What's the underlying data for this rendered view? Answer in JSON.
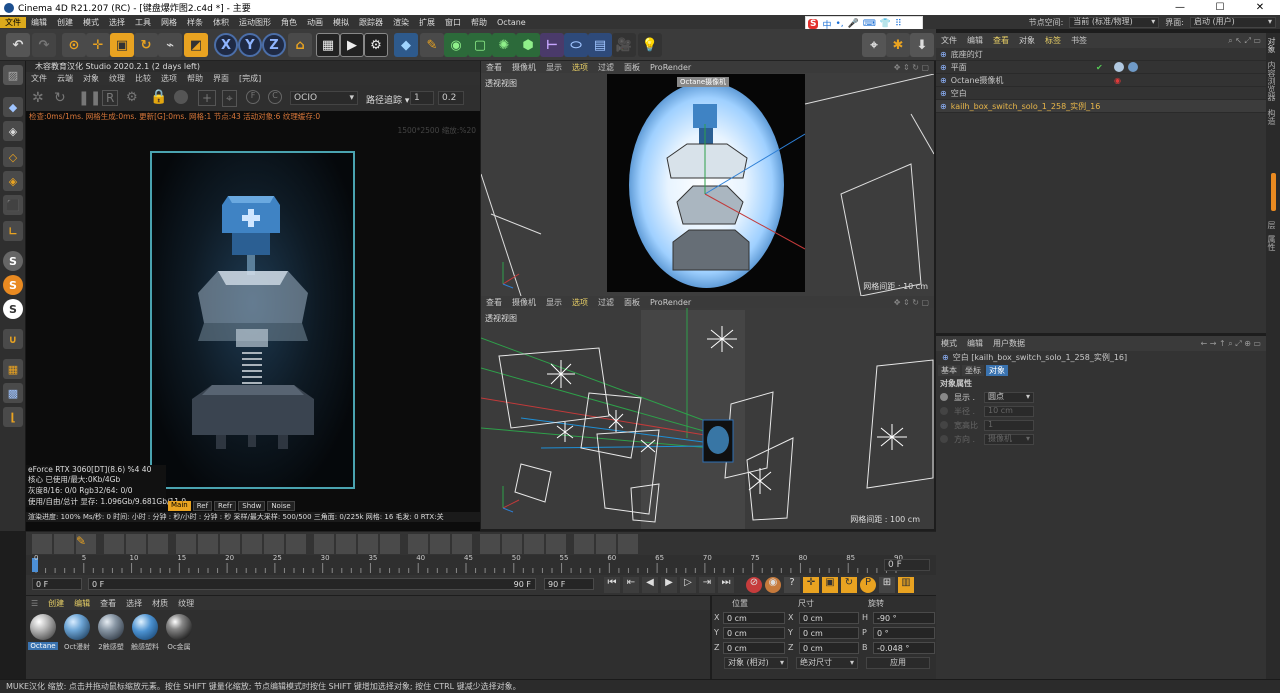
{
  "window": {
    "title": "Cinema 4D R21.207 (RC) - [键盘爆炸图2.c4d *] - 主要",
    "controls": [
      "—",
      "☐",
      "✕"
    ]
  },
  "menubar": {
    "items": [
      "文件",
      "编辑",
      "创建",
      "模式",
      "选择",
      "工具",
      "网格",
      "样条",
      "体积",
      "运动图形",
      "角色",
      "动画",
      "模拟",
      "跟踪器",
      "渲染",
      "扩展",
      "窗口",
      "帮助",
      "Octane"
    ],
    "node_space_label": "节点空间:",
    "node_space_value": "当前 (标准/物理)",
    "interface_label": "界面:",
    "interface_value": "启动 (用户)",
    "ime_items": [
      "S",
      "中",
      "•,",
      "🎤",
      "⌨",
      "👕",
      "⠿"
    ]
  },
  "live_viewer": {
    "title": "木容教育汉化 Studio 2020.2.1 (2 days left)",
    "menu": [
      "文件",
      "云端",
      "对象",
      "纹理",
      "比较",
      "选项",
      "帮助",
      "界面",
      "[完成]"
    ],
    "ocio": "OCIO",
    "path_tracing": "路径追踪",
    "spinner1": "1",
    "spinner2": "0.2",
    "status": "检查:0ms/1ms. 网格生成:0ms. 更新[G]:0ms. 网格:1 节点:43 活动对象:6 纹理缓存:0",
    "res": "1500*2500 缩放:%20",
    "gpu_line": "eForce RTX 3060[DT](8.6)  %4       40",
    "core_line": "核心 已使用/最大:0Kb/4Gb",
    "gray_line": "灰度8/16: 0/0           Rgb32/64: 0/0",
    "mem_line": "使用/自由/总计 显存: 1.096Gb/9.681Gb/11.9",
    "tabs": [
      "Main",
      "Ref",
      "Refr",
      "Shdw",
      "Noise"
    ],
    "render_line": "渲染进度: 100%  Ms/秒: 0    时间: 小时 : 分钟 : 秒/小时 : 分钟 : 秒    采样/最大采样: 500/500    三角面: 0/225k    网格: 16    毛发: 0    RTX:关"
  },
  "viewport_top": {
    "menu": [
      "查看",
      "摄像机",
      "显示",
      "选项",
      "过滤",
      "面板",
      "ProRender"
    ],
    "label": "透视视图",
    "camera_tag": "Octane摄像机",
    "grid": "网格间距 : 10 cm"
  },
  "viewport_bottom": {
    "menu": [
      "查看",
      "摄像机",
      "显示",
      "选项",
      "过滤",
      "面板",
      "ProRender"
    ],
    "label": "透视视图",
    "grid": "网格间距 : 100 cm"
  },
  "object_manager": {
    "menu": [
      "文件",
      "编辑",
      "查看",
      "对象",
      "标签",
      "书签"
    ],
    "items": [
      {
        "name": "底座的灯",
        "color": "#c8c8c8"
      },
      {
        "name": "平面",
        "color": "#c8c8c8"
      },
      {
        "name": "Octane摄像机",
        "color": "#c8c8c8"
      },
      {
        "name": "空白",
        "color": "#c8c8c8"
      },
      {
        "name": "kailh_box_switch_solo_1_258_实例_16",
        "color": "#e8b64a"
      }
    ]
  },
  "right_tabs": [
    "对象",
    "内容浏览器",
    "构造",
    "层",
    "属性"
  ],
  "attributes": {
    "menu": [
      "模式",
      "编辑",
      "用户数据"
    ],
    "object_title": "空白 [kailh_box_switch_solo_1_258_实例_16]",
    "tabs": [
      "基本",
      "坐标",
      "对象"
    ],
    "section": "对象属性",
    "fields": [
      {
        "label": "显示 .",
        "value": "圆点"
      },
      {
        "label": "半径 .",
        "value": "10 cm"
      },
      {
        "label": "宽高比",
        "value": "1"
      },
      {
        "label": "方向 .",
        "value": "摄像机"
      }
    ]
  },
  "timeline": {
    "ticks": [
      "0",
      "5",
      "10",
      "15",
      "20",
      "25",
      "30",
      "35",
      "40",
      "45",
      "50",
      "55",
      "60",
      "65",
      "70",
      "75",
      "80",
      "85",
      "90"
    ],
    "current_frame": "0 F",
    "start": "0 F",
    "start2": "0 F",
    "end": "90 F",
    "end2": "90 F"
  },
  "materials": {
    "menu": [
      "创建",
      "编辑",
      "查看",
      "选择",
      "材质",
      "纹理"
    ],
    "items": [
      "Octane",
      "Oct漫射",
      "2触感塑",
      "触感塑料",
      "Oc金属"
    ]
  },
  "coords": {
    "headers": [
      "位置",
      "尺寸",
      "旋转"
    ],
    "rows": [
      {
        "axis": "X",
        "pos": "0 cm",
        "size_axis": "X",
        "size": "0 cm",
        "rot_axis": "H",
        "rot": "-90 °"
      },
      {
        "axis": "Y",
        "pos": "0 cm",
        "size_axis": "Y",
        "size": "0 cm",
        "rot_axis": "P",
        "rot": "0 °"
      },
      {
        "axis": "Z",
        "pos": "0 cm",
        "size_axis": "Z",
        "size": "0 cm",
        "rot_axis": "B",
        "rot": "-0.048 °"
      }
    ],
    "mode1": "对象 (相对)",
    "mode2": "绝对尺寸",
    "apply": "应用"
  },
  "statusbar": {
    "text": "MUKE汉化    缩放: 点击并拖动鼠标缩放元素。按住 SHIFT 键量化缩放; 节点编辑模式时按住 SHIFT 键增加选择对象; 按住 CTRL 键减少选择对象。"
  },
  "colors": {
    "accent": "#dcaa1c",
    "selected_object": "#e8b64a",
    "viewer_frame": "#4aa3b0"
  }
}
